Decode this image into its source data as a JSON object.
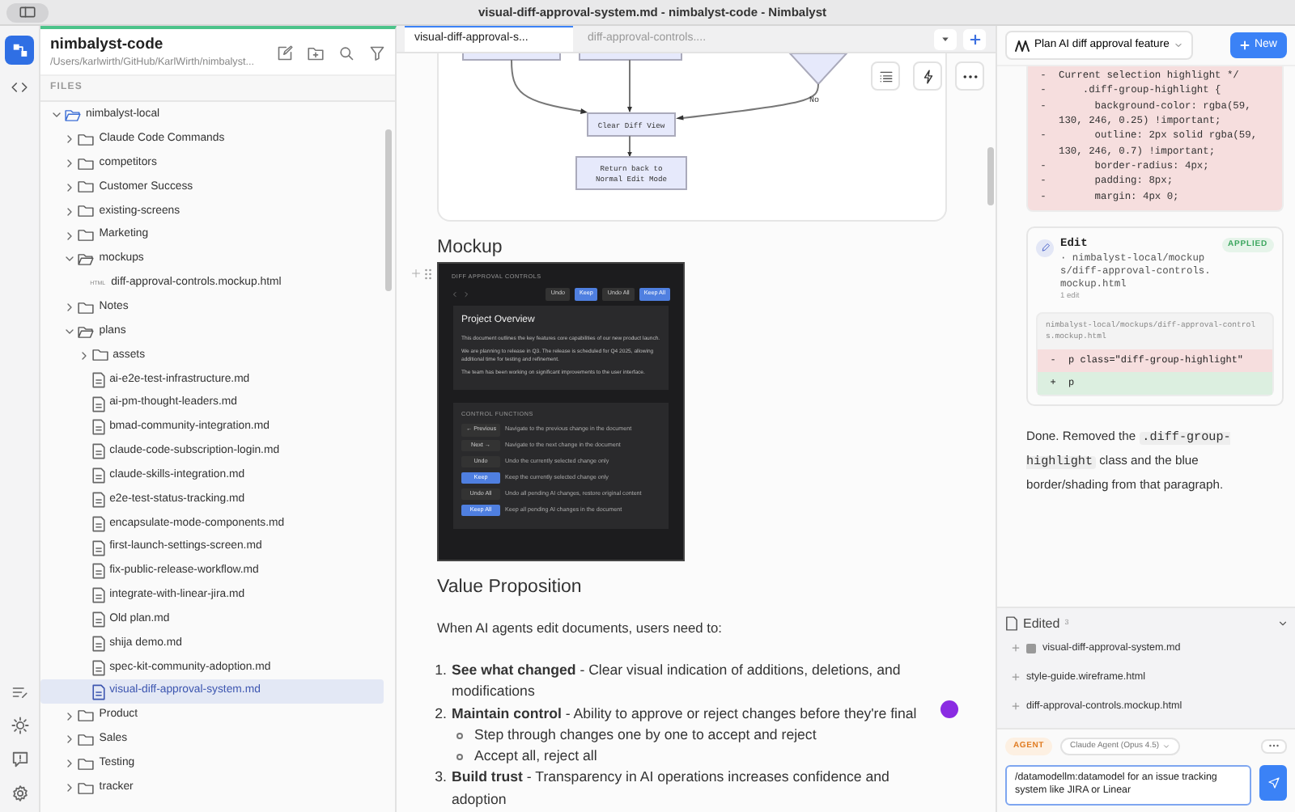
{
  "window": {
    "title": "visual-diff-approval-system.md - nimbalyst-code - Nimbalyst"
  },
  "project": {
    "name": "nimbalyst-code",
    "path": "/Users/karlwirth/GitHub/KarlWirth/nimbalyst..."
  },
  "files": {
    "label": "FILES",
    "tree": [
      {
        "name": "nimbalyst-local",
        "kind": "folder",
        "expanded": true,
        "selected": false,
        "children": [
          {
            "name": "Claude Code Commands",
            "kind": "folder",
            "expanded": false,
            "selected": false
          },
          {
            "name": "competitors",
            "kind": "folder",
            "expanded": false,
            "selected": false
          },
          {
            "name": "Customer Success",
            "kind": "folder",
            "expanded": false,
            "selected": false
          },
          {
            "name": "existing-screens",
            "kind": "folder",
            "expanded": false,
            "selected": false
          },
          {
            "name": "Marketing",
            "kind": "folder",
            "expanded": false,
            "selected": false
          },
          {
            "name": "mockups",
            "kind": "folder",
            "expanded": true,
            "selected": false,
            "children": [
              {
                "name": "diff-approval-controls.mockup.html",
                "kind": "html",
                "badge": "HTML",
                "selected": false
              }
            ]
          },
          {
            "name": "Notes",
            "kind": "folder",
            "expanded": false,
            "selected": false
          },
          {
            "name": "plans",
            "kind": "folder",
            "expanded": true,
            "selected": false,
            "children": [
              {
                "name": "assets",
                "kind": "folder",
                "expanded": false,
                "selected": false
              },
              {
                "name": "ai-e2e-test-infrastructure.md",
                "kind": "file",
                "selected": false
              },
              {
                "name": "ai-pm-thought-leaders.md",
                "kind": "file",
                "selected": false
              },
              {
                "name": "bmad-community-integration.md",
                "kind": "file",
                "selected": false
              },
              {
                "name": "claude-code-subscription-login.md",
                "kind": "file",
                "selected": false
              },
              {
                "name": "claude-skills-integration.md",
                "kind": "file",
                "selected": false
              },
              {
                "name": "e2e-test-status-tracking.md",
                "kind": "file",
                "selected": false
              },
              {
                "name": "encapsulate-mode-components.md",
                "kind": "file",
                "selected": false
              },
              {
                "name": "first-launch-settings-screen.md",
                "kind": "file",
                "selected": false
              },
              {
                "name": "fix-public-release-workflow.md",
                "kind": "file",
                "selected": false
              },
              {
                "name": "integrate-with-linear-jira.md",
                "kind": "file",
                "selected": false
              },
              {
                "name": "Old plan.md",
                "kind": "file",
                "selected": false
              },
              {
                "name": "shija demo.md",
                "kind": "file",
                "selected": false
              },
              {
                "name": "spec-kit-community-adoption.md",
                "kind": "file",
                "selected": false
              },
              {
                "name": "visual-diff-approval-system.md",
                "kind": "file",
                "selected": true
              }
            ]
          },
          {
            "name": "Product",
            "kind": "folder",
            "expanded": false,
            "selected": false
          },
          {
            "name": "Sales",
            "kind": "folder",
            "expanded": false,
            "selected": false
          },
          {
            "name": "Testing",
            "kind": "folder",
            "expanded": false,
            "selected": false
          },
          {
            "name": "tracker",
            "kind": "folder",
            "expanded": false,
            "selected": false
          }
        ]
      }
    ]
  },
  "tabs": [
    {
      "label": "visual-diff-approval-s...",
      "selected": true
    },
    {
      "label": "diff-approval-controls....",
      "selected": false
    }
  ],
  "diagram": {
    "nodes": [
      "Clear Diff View",
      "Return back to Normal Edit Mode"
    ],
    "edge_label": "No"
  },
  "document": [
    {
      "kind": "heading",
      "text": "Mockup"
    },
    {
      "kind": "mockup",
      "label": "DIFF APPROVAL CONTROLS",
      "toolbar": [
        {
          "text": "Undo",
          "kind": "secondary"
        },
        {
          "text": "Keep",
          "kind": "primary"
        },
        {
          "text": "Undo All",
          "kind": "secondary"
        },
        {
          "text": "Keep All",
          "kind": "primary"
        }
      ],
      "overview_title": "Project Overview",
      "paragraphs": [
        "This document outlines the key features core capabilities of our new product launch.",
        "We are planning to release in Q3. The release is scheduled for Q4 2025, allowing additional time for testing and refinement.",
        "The team has been working on significant improvements to the user interface."
      ],
      "controls_label": "CONTROL FUNCTIONS",
      "controls": [
        {
          "button": "← Previous",
          "kind": "secondary",
          "text": "Navigate to the previous change in the document"
        },
        {
          "button": "Next →",
          "kind": "secondary",
          "text": "Navigate to the next change in the document"
        },
        {
          "button": "Undo",
          "kind": "secondary",
          "text": "Undo the currently selected change only"
        },
        {
          "button": "Keep",
          "kind": "primary",
          "text": "Keep the currently selected change only"
        },
        {
          "button": "Undo All",
          "kind": "secondary",
          "text": "Undo all pending AI changes, restore original content"
        },
        {
          "button": "Keep All",
          "kind": "primary",
          "text": "Keep all pending AI changes in the document"
        }
      ]
    },
    {
      "kind": "heading",
      "text": "Value Proposition"
    },
    {
      "kind": "paragraph",
      "text": "When AI agents edit documents, users need to:"
    },
    {
      "kind": "list",
      "items": [
        {
          "marker": "1.",
          "text": "**See what changed** - Clear visual indication of additions, deletions, and modifications"
        },
        {
          "marker": "2.",
          "text": "**Maintain control** - Ability to approve or reject changes before they're final",
          "children": [
            {
              "text": "Step through changes one by one to accept and reject"
            },
            {
              "text": "Accept all, reject all"
            }
          ]
        },
        {
          "marker": "3.",
          "text": "**Build trust** - Transparency in AI operations increases confidence and adoption"
        }
      ]
    }
  ],
  "chat": {
    "session": "Plan AI diff approval feature",
    "new_button": "New",
    "diff_block": [
      {
        "sign": "-",
        "text": "Current selection highlight */"
      },
      {
        "sign": "-",
        "text": "    .diff-group-highlight {"
      },
      {
        "sign": "-",
        "text": "      background-color: rgba(59, 130, 246, 0.25) !important;"
      },
      {
        "sign": "-",
        "text": "      outline: 2px solid rgba(59, 130, 246, 0.7) !important;"
      },
      {
        "sign": "-",
        "text": "      border-radius: 4px;"
      },
      {
        "sign": "-",
        "text": "      padding: 8px;"
      },
      {
        "sign": "-",
        "text": "      margin: 4px 0;"
      }
    ],
    "edit": {
      "tool": "Edit",
      "status": "APPLIED",
      "target": "· nimbalyst-local/mockups/diff-approval-controls.mockup.html",
      "count": "1 edit",
      "file": "nimbalyst-local/mockups/diff-approval-controls.mockup.html",
      "lines": [
        {
          "sign": "-",
          "kind": "removed",
          "text": "p class=\"diff-group-highlight\""
        },
        {
          "sign": "+",
          "kind": "added",
          "text": "p"
        }
      ]
    },
    "message": [
      {
        "kind": "text",
        "text": "Done. Removed the "
      },
      {
        "kind": "code",
        "text": ".diff-group-highlight"
      },
      {
        "kind": "text",
        "text": " class and the blue border/shading from that paragraph."
      }
    ],
    "edited": {
      "label": "Edited",
      "count": "3",
      "files": [
        {
          "name": "visual-diff-approval-system.md",
          "kind": "doc"
        },
        {
          "name": "style-guide.wireframe.html",
          "kind": "plain"
        },
        {
          "name": "diff-approval-controls.mockup.html",
          "kind": "plain"
        }
      ]
    },
    "agent_label": "AGENT",
    "model": "Claude Agent (Opus 4.5)",
    "input": {
      "value": "/datamodellm:datamodel for an issue tracking system like JIRA or Linear"
    }
  }
}
